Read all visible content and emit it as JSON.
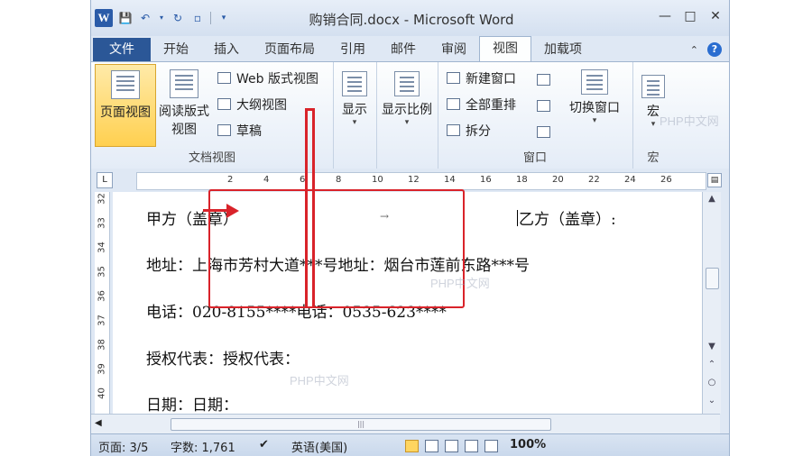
{
  "window": {
    "title": "购销合同.docx - Microsoft Word",
    "app_letter": "W",
    "accent": "#2b5797"
  },
  "tabs": {
    "file": "文件",
    "items": [
      "开始",
      "插入",
      "页面布局",
      "引用",
      "邮件",
      "审阅",
      "视图",
      "加载项"
    ],
    "active": "视图"
  },
  "ribbon": {
    "doc_views": {
      "print_layout": "页面视图",
      "reading_line1": "阅读版式",
      "reading_line2": "视图",
      "web_layout": "Web 版式视图",
      "outline": "大纲视图",
      "draft": "草稿",
      "label": "文档视图"
    },
    "show": {
      "label": "显示"
    },
    "zoom": {
      "label": "显示比例"
    },
    "window": {
      "new_window": "新建窗口",
      "arrange_all": "全部重排",
      "split": "拆分",
      "switch_windows": "切换窗口",
      "label": "窗口"
    },
    "macros": {
      "button": "宏",
      "label": "宏"
    }
  },
  "ruler": {
    "ticks": [
      "2",
      "4",
      "6",
      "8",
      "10",
      "12",
      "14",
      "16",
      "18",
      "20",
      "22",
      "24",
      "26"
    ]
  },
  "vruler": {
    "ticks": [
      "32",
      "33",
      "34",
      "35",
      "36",
      "37",
      "38",
      "39",
      "40"
    ]
  },
  "document": {
    "line1_left": "甲方（盖章）",
    "line1_right": "乙方（盖章）:",
    "line2": "地址：上海市芳村大道***号地址：烟台市莲前东路***号",
    "line3": "电话：020-8155****电话：0535-623****",
    "line4": "授权代表：授权代表：",
    "line5": "日期：日期："
  },
  "status": {
    "page": "页面: 3/5",
    "words": "字数: 1,761",
    "language": "英语(美国)",
    "zoom": "100%"
  },
  "watermark": "PHP中文网"
}
